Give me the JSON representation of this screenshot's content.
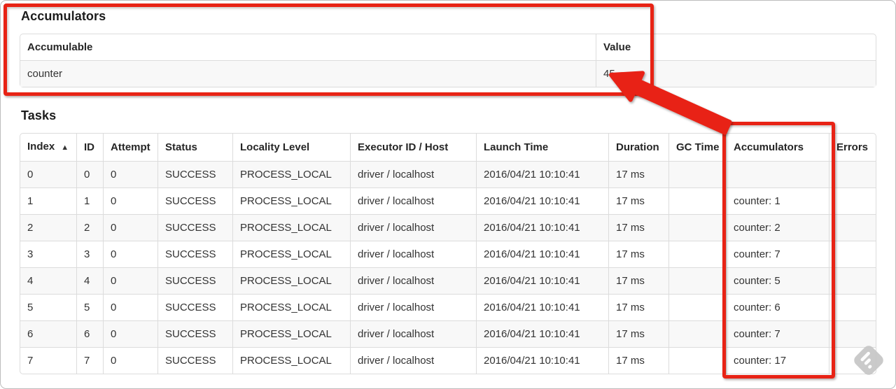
{
  "accumulators_section": {
    "heading": "Accumulators",
    "table": {
      "headers": [
        "Accumulable",
        "Value"
      ],
      "rows": [
        [
          "counter",
          "45"
        ]
      ]
    }
  },
  "tasks_section": {
    "heading": "Tasks",
    "table": {
      "headers": [
        "Index",
        "ID",
        "Attempt",
        "Status",
        "Locality Level",
        "Executor ID / Host",
        "Launch Time",
        "Duration",
        "GC Time",
        "Accumulators",
        "Errors"
      ],
      "sort": {
        "column": "Index",
        "direction": "ascending",
        "indicator": "▲"
      },
      "rows": [
        [
          "0",
          "0",
          "0",
          "SUCCESS",
          "PROCESS_LOCAL",
          "driver / localhost",
          "2016/04/21 10:10:41",
          "17 ms",
          "",
          "",
          ""
        ],
        [
          "1",
          "1",
          "0",
          "SUCCESS",
          "PROCESS_LOCAL",
          "driver / localhost",
          "2016/04/21 10:10:41",
          "17 ms",
          "",
          "counter: 1",
          ""
        ],
        [
          "2",
          "2",
          "0",
          "SUCCESS",
          "PROCESS_LOCAL",
          "driver / localhost",
          "2016/04/21 10:10:41",
          "17 ms",
          "",
          "counter: 2",
          ""
        ],
        [
          "3",
          "3",
          "0",
          "SUCCESS",
          "PROCESS_LOCAL",
          "driver / localhost",
          "2016/04/21 10:10:41",
          "17 ms",
          "",
          "counter: 7",
          ""
        ],
        [
          "4",
          "4",
          "0",
          "SUCCESS",
          "PROCESS_LOCAL",
          "driver / localhost",
          "2016/04/21 10:10:41",
          "17 ms",
          "",
          "counter: 5",
          ""
        ],
        [
          "5",
          "5",
          "0",
          "SUCCESS",
          "PROCESS_LOCAL",
          "driver / localhost",
          "2016/04/21 10:10:41",
          "17 ms",
          "",
          "counter: 6",
          ""
        ],
        [
          "6",
          "6",
          "0",
          "SUCCESS",
          "PROCESS_LOCAL",
          "driver / localhost",
          "2016/04/21 10:10:41",
          "17 ms",
          "",
          "counter: 7",
          ""
        ],
        [
          "7",
          "7",
          "0",
          "SUCCESS",
          "PROCESS_LOCAL",
          "driver / localhost",
          "2016/04/21 10:10:41",
          "17 ms",
          "",
          "counter: 17",
          ""
        ]
      ]
    }
  },
  "annotations": {
    "color": "#e82315",
    "boxes": [
      "accumulators-summary-highlight",
      "tasks-accumulators-column-highlight"
    ],
    "arrow": {
      "points_to": "45"
    }
  }
}
